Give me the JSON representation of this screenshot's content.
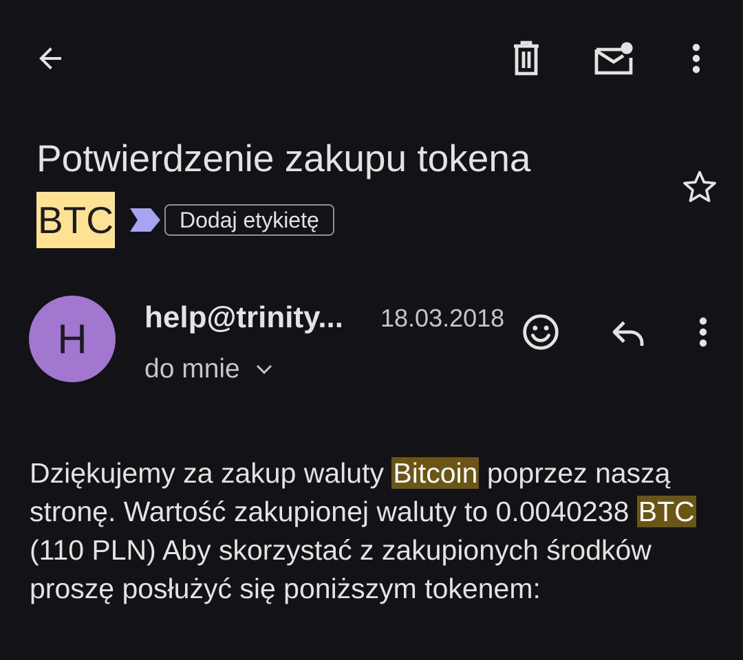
{
  "toolbar": {
    "back_icon": "arrow-back-icon",
    "delete_icon": "trash-icon",
    "mark_unread_icon": "mail-unread-icon",
    "overflow_icon": "more-vert-icon"
  },
  "subject": {
    "line1": "Potwierdzenie zakupu tokena",
    "highlight": "BTC",
    "highlight_color": "#fde293",
    "importance_icon": "importance-marker-icon",
    "importance_color": "#a8a4f4",
    "label_chip": "Dodaj etykietę",
    "star_icon": "star-outline-icon"
  },
  "message": {
    "avatar_letter": "H",
    "avatar_color": "#a277cf",
    "sender": "help@trinity...",
    "date": "18.03.2018",
    "recipient": "do mnie",
    "emoji_icon": "emoji-reaction-icon",
    "reply_icon": "reply-icon",
    "overflow_icon": "more-vert-icon"
  },
  "body": {
    "highlight_color": "#6b5514",
    "seg1": "Dziękujemy za zakup waluty ",
    "hl1": "Bitcoin",
    "seg2": " poprzez naszą stronę. Wartość zakupionej waluty to 0.0040238 ",
    "hl2": "BTC",
    "seg3": " (110 PLN) Aby skorzystać z zakupionych środków proszę posłużyć się poniższym tokenem:"
  }
}
